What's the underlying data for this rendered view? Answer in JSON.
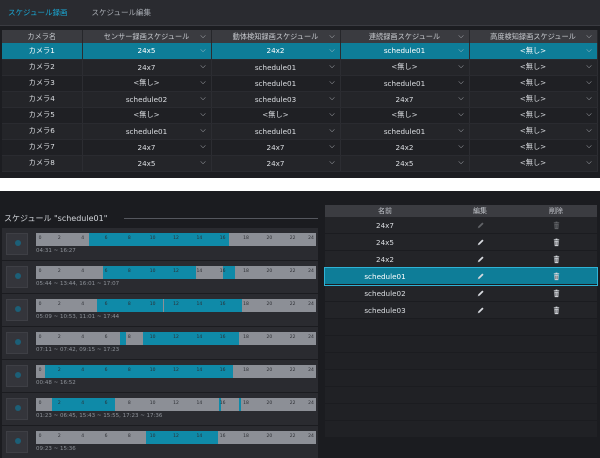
{
  "tabs": [
    {
      "label": "スケジュール録画",
      "active": true
    },
    {
      "label": "スケジュール編集",
      "active": false
    }
  ],
  "camera_table": {
    "headers": [
      "カメラ名",
      "センサー録画スケジュール",
      "動体検知録画スケジュール",
      "連続録画スケジュール",
      "高度検知録画スケジュール"
    ],
    "rows": [
      {
        "camera": "カメラ1",
        "sensor": "24x5",
        "motion": "24x2",
        "continuous": "schedule01",
        "advanced": "<無し>",
        "selected": true
      },
      {
        "camera": "カメラ2",
        "sensor": "24x7",
        "motion": "schedule01",
        "continuous": "<無し>",
        "advanced": "<無し>",
        "selected": false
      },
      {
        "camera": "カメラ3",
        "sensor": "<無し>",
        "motion": "schedule01",
        "continuous": "schedule01",
        "advanced": "<無し>",
        "selected": false
      },
      {
        "camera": "カメラ4",
        "sensor": "schedule02",
        "motion": "schedule03",
        "continuous": "24x7",
        "advanced": "<無し>",
        "selected": false
      },
      {
        "camera": "カメラ5",
        "sensor": "<無し>",
        "motion": "<無し>",
        "continuous": "<無し>",
        "advanced": "<無し>",
        "selected": false
      },
      {
        "camera": "カメラ6",
        "sensor": "schedule01",
        "motion": "schedule01",
        "continuous": "schedule01",
        "advanced": "<無し>",
        "selected": false
      },
      {
        "camera": "カメラ7",
        "sensor": "24x7",
        "motion": "24x7",
        "continuous": "24x2",
        "advanced": "<無し>",
        "selected": false
      },
      {
        "camera": "カメラ8",
        "sensor": "24x5",
        "motion": "24x7",
        "continuous": "24x5",
        "advanced": "<無し>",
        "selected": false
      }
    ]
  },
  "schedule_view": {
    "title": "スケジュール \"schedule01\"",
    "hour_labels": [
      "0",
      "2",
      "4",
      "6",
      "8",
      "10",
      "12",
      "14",
      "16",
      "18",
      "20",
      "22",
      "24"
    ],
    "days": [
      {
        "segments": [
          [
            4.5,
            16.5
          ]
        ],
        "ranges": "04:31 ~ 16:27"
      },
      {
        "segments": [
          [
            5.7,
            13.7
          ],
          [
            16.0,
            17.1
          ]
        ],
        "ranges": "05:44 ~ 13:44,   16:01 ~ 17:07"
      },
      {
        "segments": [
          [
            5.2,
            10.9
          ],
          [
            11.0,
            17.7
          ]
        ],
        "ranges": "05:09 ~ 10:53,   11:01 ~ 17:44"
      },
      {
        "segments": [
          [
            7.2,
            7.7
          ],
          [
            9.2,
            17.4
          ]
        ],
        "ranges": "07:11 ~ 07:42,   09:15 ~ 17:23"
      },
      {
        "segments": [
          [
            0.8,
            16.9
          ]
        ],
        "ranges": "00:48 ~ 16:52"
      },
      {
        "segments": [
          [
            1.4,
            6.8
          ],
          [
            15.7,
            15.9
          ],
          [
            17.4,
            17.6
          ]
        ],
        "ranges": "01:23 ~ 06:45,   15:43 ~ 15:55,   17:23 ~ 17:36"
      },
      {
        "segments": [
          [
            9.4,
            15.6
          ]
        ],
        "ranges": "09:23 ~ 15:36"
      }
    ],
    "colors": {
      "active": "#0f8aa8",
      "inactive": "#8c8f96"
    }
  },
  "schedule_list": {
    "headers": {
      "name": "名前",
      "edit": "編集",
      "delete": "削除"
    },
    "items": [
      {
        "name": "24x7",
        "editable": false,
        "selected": false
      },
      {
        "name": "24x5",
        "editable": true,
        "selected": false
      },
      {
        "name": "24x2",
        "editable": true,
        "selected": false
      },
      {
        "name": "schedule01",
        "editable": true,
        "selected": true
      },
      {
        "name": "schedule02",
        "editable": true,
        "selected": false
      },
      {
        "name": "schedule03",
        "editable": true,
        "selected": false
      }
    ],
    "empty_rows": 7
  }
}
